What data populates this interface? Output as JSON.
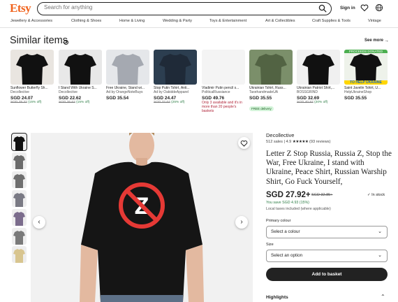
{
  "header": {
    "logo": "Etsy",
    "search_placeholder": "Search for anything",
    "signin": "Sign in"
  },
  "nav": [
    "Jewellery & Accessories",
    "Clothing & Shoes",
    "Home & Living",
    "Wedding & Party",
    "Toys & Entertainment",
    "Art & Collectibles",
    "Craft Supplies & Tools",
    "Vintage"
  ],
  "similar": {
    "title": "Similar items",
    "see_more": "See more",
    "items": [
      {
        "title": "Sunflower Butterfly Sh...",
        "shop": "Decollective",
        "price": "SGD 24.07",
        "orig_price": "SGD 28.32",
        "discount": "(15% off)",
        "bg": "#e9e5e0",
        "shirt": "#111111"
      },
      {
        "title": "I Stand With Ukraine S...",
        "shop": "Decollective",
        "price": "SGD 22.62",
        "orig_price": "SGD 26.62",
        "discount": "(15% off)",
        "bg": "#e8e8e8",
        "shirt": "#111111"
      },
      {
        "title": "Free Ukraine, Stand wi...",
        "shop": "Ad by OrangeNoteBuys",
        "price": "SGD 35.54",
        "orig_price": "",
        "discount": "",
        "bg": "#e5e7ea",
        "shirt": "#a5a9b1"
      },
      {
        "title": "Stop Putin Tshirt, Anti...",
        "shop": "Ad by OakiddeApparel",
        "price": "SGD 24.47",
        "orig_price": "SGD 32.64",
        "discount": "(25% off)",
        "bg": "#2c3e50",
        "shirt": "#1f2a38"
      },
      {
        "title": "Vladimir Putin pencil s...",
        "shop": "PoliticalRussiance",
        "price": "SGD 49.76",
        "orig_price": "",
        "discount": "",
        "warn": "Only 3 available and it's in more than 20 people's baskets",
        "bg": "#f4f4f4",
        "shirt": "#f4f4f4"
      },
      {
        "title": "Ukrainian Tshirt, Russ...",
        "shop": "TaxehandmadeUA",
        "price": "SGD 35.55",
        "orig_price": "",
        "discount": "",
        "badge": "FREE delivery",
        "bg": "#7b8f6a",
        "shirt": "#526343"
      },
      {
        "title": "Ukrainian Patriot Shirt,...",
        "shop": "BOSSGRIND",
        "price": "SGD 32.69",
        "orig_price": "SGD 40.87",
        "discount": "(20% off)",
        "bg": "#f0f0f0",
        "shirt": "#111111"
      },
      {
        "title": "Saint Javelin Tshirt, U...",
        "shop": "HelpUkraineShop",
        "price": "SGD 35.55",
        "orig_price": "",
        "discount": "",
        "banner_top": "PROCEEDS DONATED",
        "banner_bottom": "TO HELP UKRAINE",
        "bg": "#eef2ea",
        "shirt": "#111111"
      }
    ]
  },
  "product": {
    "shop_name": "Decollective",
    "sales": "512 sales",
    "rating": "4.9",
    "stars": "★★★★★",
    "reviews": "(93 reviews)",
    "title": "Letter Z Stop Russia, Russia Z, Stop the War, Free Ukraine, I stand with Ukraine, Peace Shirt, Russian Warship Shirt, Go Fuck Yourself,",
    "price": "SGD 27.92+",
    "orig_price": "SGD 32.85+",
    "stock": "In stock",
    "save": "You save SGD 4.93 (15%)",
    "taxes": "Local taxes included (where applicable)",
    "colour_label": "Primary colour",
    "colour_value": "Select a colour",
    "size_label": "Size",
    "size_value": "Select an option",
    "basket": "Add to basket",
    "highlights": "Highlights"
  },
  "thumbnail_colors": [
    "#111111",
    "#6b6b6b",
    "#6f6f6f",
    "#7a7a84",
    "#7b6c8c",
    "#7a7a7a",
    "#d8c58f"
  ],
  "colors": {
    "brand": "#f1641e",
    "sale_green": "#2d7d46",
    "warn_red": "#b1273b",
    "button": "#222222"
  }
}
